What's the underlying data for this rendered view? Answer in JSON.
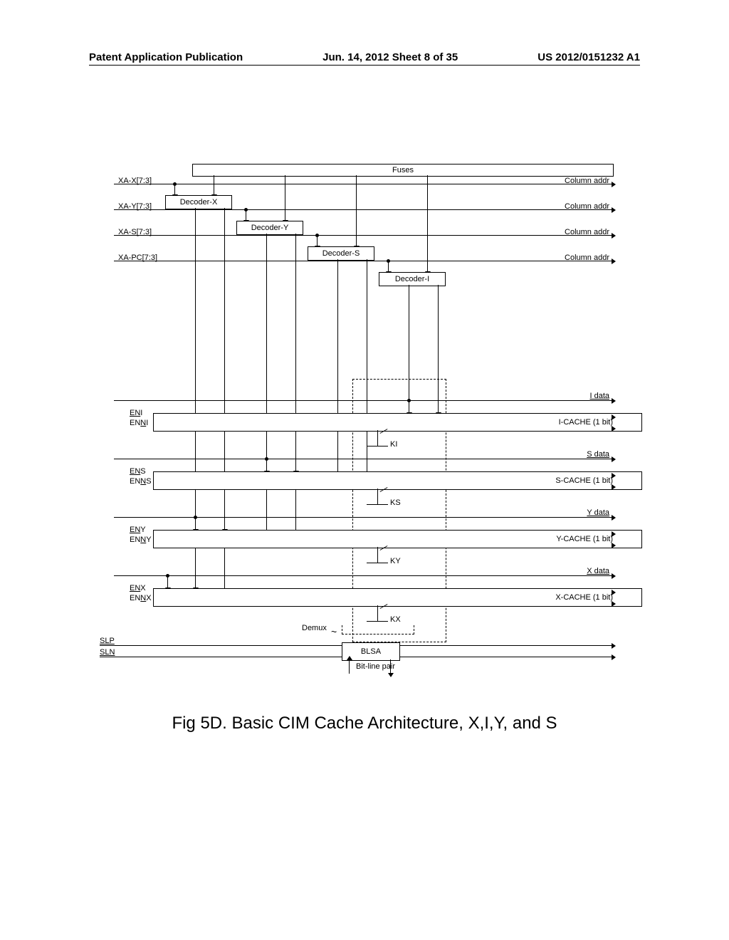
{
  "header": {
    "left": "Patent Application Publication",
    "center": "Jun. 14, 2012  Sheet 8 of 35",
    "right": "US 2012/0151232 A1"
  },
  "fuses": "Fuses",
  "inputs": {
    "xa_x": "XA-X[7:3]",
    "xa_y": "XA-Y[7:3]",
    "xa_s": "XA-S[7:3]",
    "xa_pc": "XA-PC[7:3]"
  },
  "column_addr": "Column addr",
  "decoders": {
    "x": "Decoder-X",
    "y": "Decoder-Y",
    "s": "Decoder-S",
    "i": "Decoder-I"
  },
  "data_lines": {
    "i": "I data",
    "s": "S data",
    "y": "Y data",
    "x": "X data"
  },
  "enables": {
    "eni": "ENI",
    "enni": "ENNI",
    "ens": "ENS",
    "enns": "ENNS",
    "eny": "ENY",
    "enny": "ENNY",
    "enx": "ENX",
    "ennx": "ENNX"
  },
  "caches": {
    "i": "I-CACHE (1 bit)",
    "s": "S-CACHE (1 bit)",
    "y": "Y-CACHE (1 bit)",
    "x": "X-CACHE (1 bit)"
  },
  "k_labels": {
    "ki": "KI",
    "ks": "KS",
    "ky": "KY",
    "kx": "KX"
  },
  "demux": "Demux",
  "slp": "SLP",
  "sln": "SLN",
  "blsa": "BLSA",
  "bitline": "Bit-line pair",
  "caption": "Fig 5D. Basic CIM Cache Architecture, X,I,Y, and S"
}
